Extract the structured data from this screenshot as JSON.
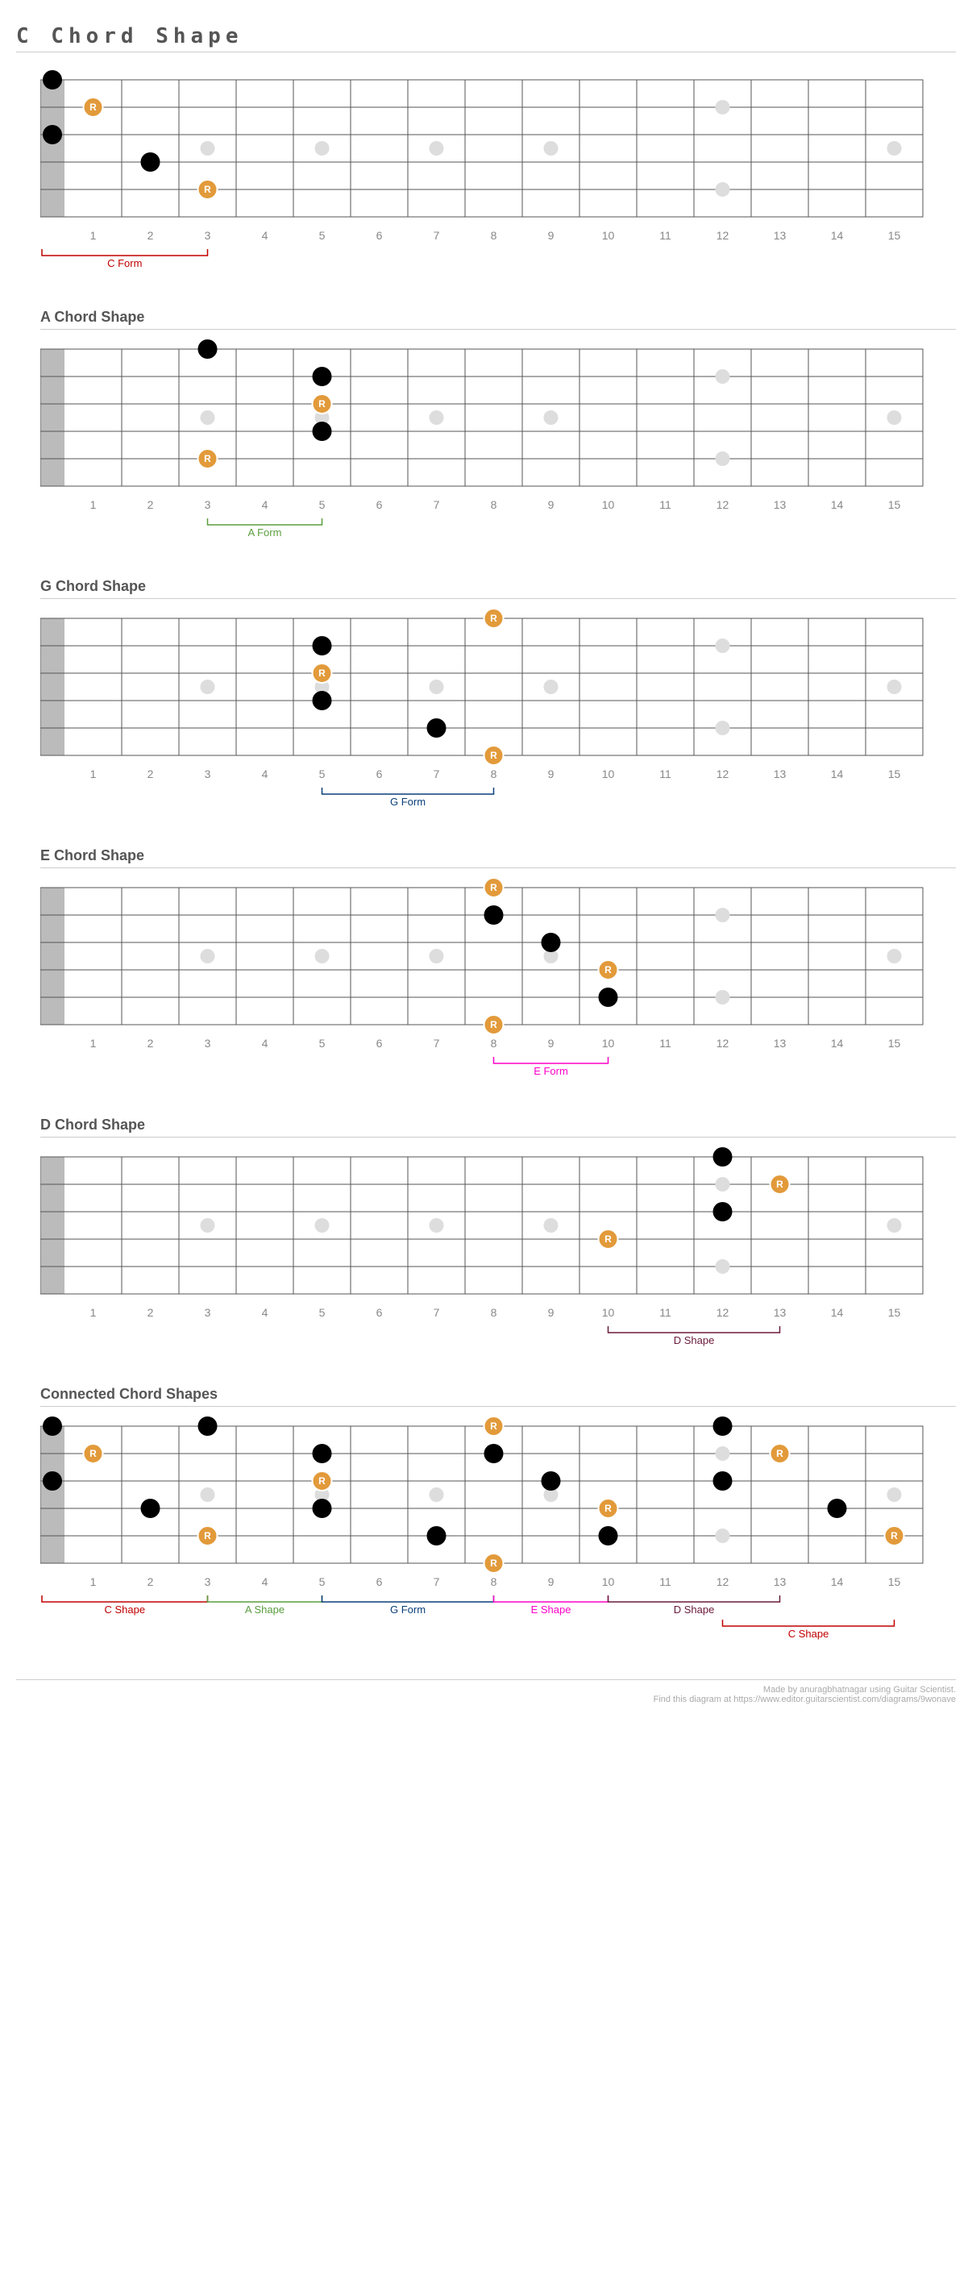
{
  "mainTitle": "C Chord Shape",
  "colors": {
    "root": "#e29a3a",
    "inlay": "#ddd",
    "fret": "#555",
    "string": "#555",
    "C": "#c00000",
    "A": "#5a9e3e",
    "G": "#0a3f7a",
    "E": "#ff00c8",
    "D": "#6a1a3a"
  },
  "fretCount": 15,
  "stringCount": 6,
  "inlayFrets": [
    3,
    5,
    7,
    9,
    12,
    15
  ],
  "doubleInlayFrets": [
    12
  ],
  "diagrams": [
    {
      "title": null,
      "notes": [
        {
          "s": 1,
          "f": 0,
          "type": "black"
        },
        {
          "s": 2,
          "f": 1,
          "type": "root"
        },
        {
          "s": 3,
          "f": 0,
          "type": "black"
        },
        {
          "s": 4,
          "f": 2,
          "type": "black"
        },
        {
          "s": 5,
          "f": 3,
          "type": "root"
        }
      ],
      "brackets": [
        {
          "from": 0,
          "to": 3,
          "label": "C Form",
          "color": "C"
        }
      ]
    },
    {
      "title": "A Chord Shape",
      "notes": [
        {
          "s": 1,
          "f": 3,
          "type": "black"
        },
        {
          "s": 2,
          "f": 5,
          "type": "black"
        },
        {
          "s": 3,
          "f": 5,
          "type": "root"
        },
        {
          "s": 4,
          "f": 5,
          "type": "black"
        },
        {
          "s": 5,
          "f": 3,
          "type": "root"
        }
      ],
      "brackets": [
        {
          "from": 3,
          "to": 5,
          "label": "A Form",
          "color": "A"
        }
      ]
    },
    {
      "title": "G Chord Shape",
      "notes": [
        {
          "s": 1,
          "f": 8,
          "type": "root"
        },
        {
          "s": 2,
          "f": 5,
          "type": "black"
        },
        {
          "s": 3,
          "f": 5,
          "type": "root"
        },
        {
          "s": 4,
          "f": 5,
          "type": "black"
        },
        {
          "s": 5,
          "f": 7,
          "type": "black"
        },
        {
          "s": 6,
          "f": 8,
          "type": "root"
        }
      ],
      "brackets": [
        {
          "from": 5,
          "to": 8,
          "label": "G Form",
          "color": "G"
        }
      ]
    },
    {
      "title": "E Chord Shape",
      "notes": [
        {
          "s": 1,
          "f": 8,
          "type": "root"
        },
        {
          "s": 2,
          "f": 8,
          "type": "black"
        },
        {
          "s": 3,
          "f": 9,
          "type": "black"
        },
        {
          "s": 4,
          "f": 10,
          "type": "root"
        },
        {
          "s": 5,
          "f": 10,
          "type": "black"
        },
        {
          "s": 6,
          "f": 8,
          "type": "root"
        }
      ],
      "brackets": [
        {
          "from": 8,
          "to": 10,
          "label": "E Form",
          "color": "E"
        }
      ]
    },
    {
      "title": "D Chord Shape",
      "notes": [
        {
          "s": 1,
          "f": 12,
          "type": "black"
        },
        {
          "s": 2,
          "f": 13,
          "type": "root"
        },
        {
          "s": 3,
          "f": 12,
          "type": "black"
        },
        {
          "s": 4,
          "f": 10,
          "type": "root"
        }
      ],
      "brackets": [
        {
          "from": 10,
          "to": 13,
          "label": "D Shape",
          "color": "D"
        }
      ]
    },
    {
      "title": "Connected Chord Shapes",
      "notes": [
        {
          "s": 1,
          "f": 0,
          "type": "black"
        },
        {
          "s": 2,
          "f": 1,
          "type": "root"
        },
        {
          "s": 3,
          "f": 0,
          "type": "black"
        },
        {
          "s": 4,
          "f": 2,
          "type": "black"
        },
        {
          "s": 5,
          "f": 3,
          "type": "root"
        },
        {
          "s": 1,
          "f": 3,
          "type": "black"
        },
        {
          "s": 2,
          "f": 5,
          "type": "black"
        },
        {
          "s": 3,
          "f": 5,
          "type": "root"
        },
        {
          "s": 4,
          "f": 5,
          "type": "black"
        },
        {
          "s": 1,
          "f": 8,
          "type": "root"
        },
        {
          "s": 2,
          "f": 8,
          "type": "black"
        },
        {
          "s": 5,
          "f": 7,
          "type": "black"
        },
        {
          "s": 6,
          "f": 8,
          "type": "root"
        },
        {
          "s": 3,
          "f": 9,
          "type": "black"
        },
        {
          "s": 4,
          "f": 10,
          "type": "root"
        },
        {
          "s": 5,
          "f": 10,
          "type": "black"
        },
        {
          "s": 1,
          "f": 12,
          "type": "black"
        },
        {
          "s": 2,
          "f": 13,
          "type": "root"
        },
        {
          "s": 3,
          "f": 12,
          "type": "black"
        },
        {
          "s": 4,
          "f": 14,
          "type": "black"
        },
        {
          "s": 5,
          "f": 15,
          "type": "root"
        }
      ],
      "brackets": [
        {
          "from": 0,
          "to": 3,
          "label": "C Shape",
          "color": "C",
          "row": 0
        },
        {
          "from": 3,
          "to": 5,
          "label": "A Shape",
          "color": "A",
          "row": 0
        },
        {
          "from": 5,
          "to": 8,
          "label": "G Form",
          "color": "G",
          "row": 0
        },
        {
          "from": 8,
          "to": 10,
          "label": "E Shape",
          "color": "E",
          "row": 0
        },
        {
          "from": 10,
          "to": 13,
          "label": "D Shape",
          "color": "D",
          "row": 0
        },
        {
          "from": 12,
          "to": 15,
          "label": "C Shape",
          "color": "C",
          "row": 1
        }
      ]
    }
  ],
  "footer": {
    "line1": "Made by anuragbhatnagar using Guitar Scientist.",
    "line2": "Find this diagram at https://www.editor.guitarscientist.com/diagrams/9wonave"
  }
}
